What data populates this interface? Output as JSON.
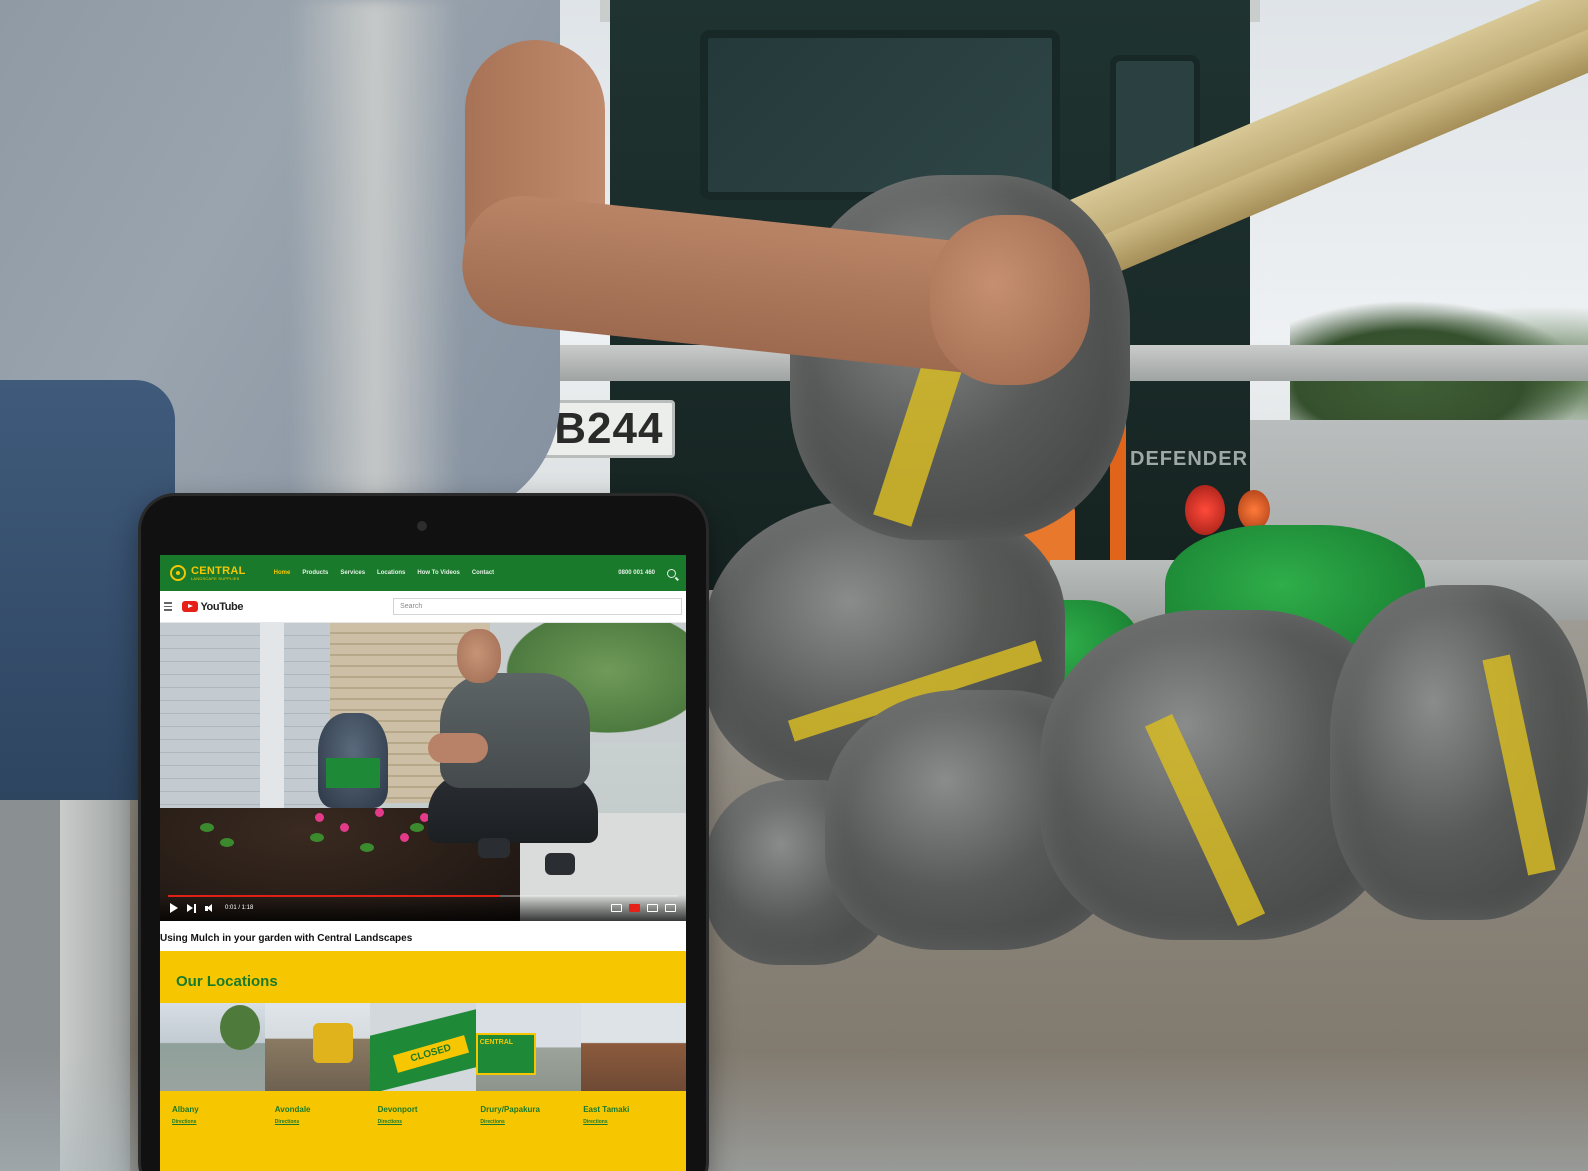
{
  "scene": {
    "truck_badge": "DEFENDER",
    "plate": "MB244"
  },
  "site": {
    "logo_text": "CENTRAL",
    "logo_subtext": "LANDSCAPE SUPPLIES",
    "nav": [
      "Home",
      "Products",
      "Services",
      "Locations",
      "How To Videos",
      "Contact"
    ],
    "phone": "0800 001 460"
  },
  "youtube": {
    "brand": "YouTube",
    "search_placeholder": "Search",
    "time": "0:01 / 1:18",
    "progress": 0.65,
    "video_title": "Using Mulch in your garden with Central Landscapes"
  },
  "locations": {
    "heading": "Our Locations",
    "closed_label": "CLOSED",
    "sign_text": "CENTRAL",
    "items": [
      {
        "name": "Albany",
        "link": "Directions"
      },
      {
        "name": "Avondale",
        "link": "Directions"
      },
      {
        "name": "Devonport",
        "link": "Directions"
      },
      {
        "name": "Drury/Papakura",
        "link": "Directions"
      },
      {
        "name": "East Tamaki",
        "link": "Directions"
      }
    ]
  },
  "colors": {
    "brand_green": "#1a7a2c",
    "brand_yellow": "#f6c700",
    "youtube_red": "#e62117"
  }
}
